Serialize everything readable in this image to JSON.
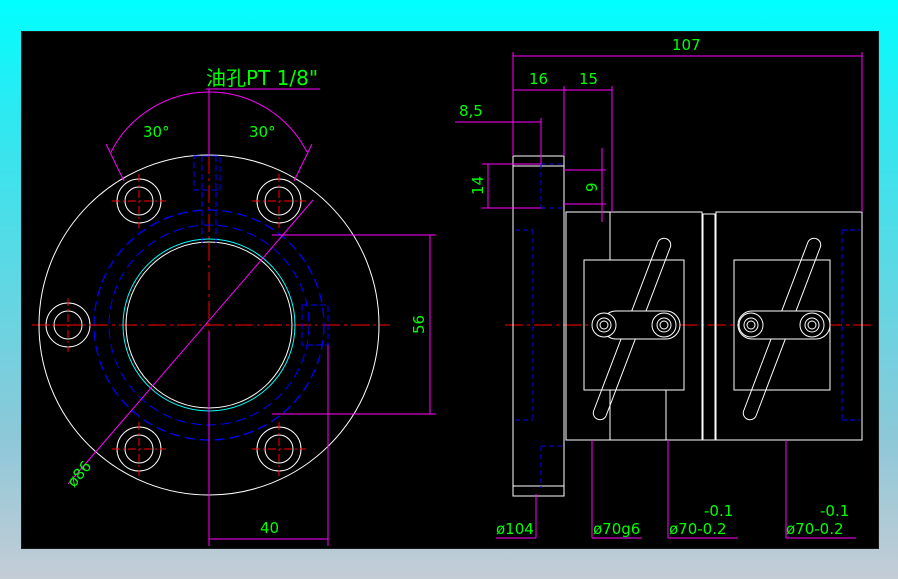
{
  "drawing": {
    "oil_hole_note": "油孔PT 1/8\"",
    "dimensions": {
      "angle_left": "30°",
      "angle_right": "30°",
      "bolt_circle_dia": "ø86",
      "height_56": "56",
      "width_40": "40",
      "overall_length": "107",
      "flange_thickness": "16",
      "offset_15": "15",
      "hole_depth": "8,5",
      "hole_height": "14",
      "hole_dia": "9",
      "flange_dia": "ø104",
      "body_dia": "ø70g6",
      "tol_upper_1": "-0.1",
      "tol_dia_1": "ø70-0.2",
      "tol_upper_2": "-0.1",
      "tol_dia_2": "ø70-0.2"
    }
  },
  "colors": {
    "background": "#000000",
    "outline": "#ffffff",
    "dimension": "#ff00ff",
    "text": "#00ff00",
    "centerline": "#ff0000",
    "hidden": "#0000ff",
    "accent": "#00ffff"
  }
}
